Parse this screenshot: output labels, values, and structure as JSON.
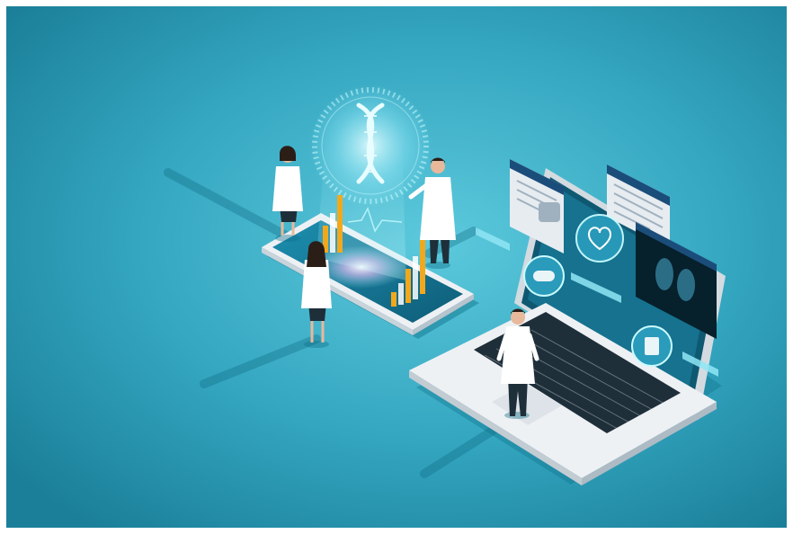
{
  "illustration": {
    "subject": "isometric-digital-health",
    "icons": [
      "dna-icon",
      "brain-icon",
      "heart-rate-icon",
      "pills-icon",
      "lungs-icon",
      "medicine-bottle-icon"
    ],
    "colors": {
      "background_center": "#4fc0d6",
      "background_edge": "#1b7f99",
      "device_body": "#eef1f4",
      "screen_dark": "#0b3a4c",
      "hologram": "#bff7ff",
      "bar_orange": "#f2a81d",
      "panel_header": "#1b4d7a",
      "coat": "#ffffff"
    }
  }
}
